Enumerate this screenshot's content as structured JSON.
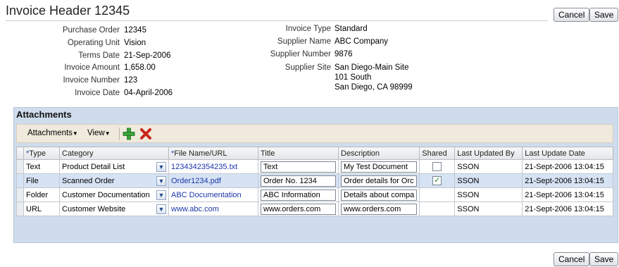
{
  "header": {
    "title": "Invoice Header 12345",
    "cancel_label": "Cancel",
    "save_label": "Save"
  },
  "details_left": [
    {
      "label": "Purchase Order",
      "value": "12345"
    },
    {
      "label": "Operating Unit",
      "value": "Vision"
    },
    {
      "label": "Terms Date",
      "value": "21-Sep-2006"
    },
    {
      "label": "Invoice Amount",
      "value": "1,658.00"
    },
    {
      "label": "Invoice Number",
      "value": "123"
    },
    {
      "label": "Invoice Date",
      "value": "04-April-2006"
    }
  ],
  "details_right": [
    {
      "label": "Invoice Type",
      "value": "Standard"
    },
    {
      "label": "Supplier Name",
      "value": "ABC Company"
    },
    {
      "label": "Supplier Number",
      "value": "9876"
    },
    {
      "label": "Supplier Site",
      "value": "San Diego-Main Site",
      "value2": "101 South",
      "value3": "San Diego, CA 98999"
    }
  ],
  "attachments": {
    "title": "Attachments",
    "toolbar": {
      "menu1": "Attachments",
      "menu2": "View"
    },
    "columns": {
      "type_req": "*",
      "type": "Type",
      "category": "Category",
      "file_req": "*",
      "file": "File Name/URL",
      "title": "Title",
      "description": "Description",
      "shared": "Shared",
      "updated_by": "Last Updated By",
      "update_date": "Last Update Date"
    },
    "rows": [
      {
        "type": "Text",
        "category": "Product Detail List",
        "file": "1234342354235.txt",
        "title": "Text",
        "description": "My Test Document",
        "shared": "",
        "updated_by": "SSON",
        "update_date": "21-Sept-2006 13:04:15"
      },
      {
        "type": "File",
        "category": "Scanned Order",
        "file": "Order1234.pdf",
        "title": "Order No. 1234",
        "description": "Order details for Orc",
        "shared": "✓",
        "updated_by": "SSON",
        "update_date": "21-Sept-2006 13:04:15"
      },
      {
        "type": "Folder",
        "category": "Customer Documentation",
        "file": "ABC Documentation",
        "title": "ABC Information",
        "description": "Details about compa",
        "shared": "",
        "updated_by": "SSON",
        "update_date": "21-Sept-2006 13:04:15"
      },
      {
        "type": "URL",
        "category": "Customer Website",
        "file": "www.abc.com",
        "title": "www.orders.com",
        "description": "www.orders.com",
        "shared": "",
        "updated_by": "SSON",
        "update_date": "21-Sept-2006 13:04:15"
      }
    ]
  },
  "footer": {
    "cancel_label": "Cancel",
    "save_label": "Save"
  }
}
